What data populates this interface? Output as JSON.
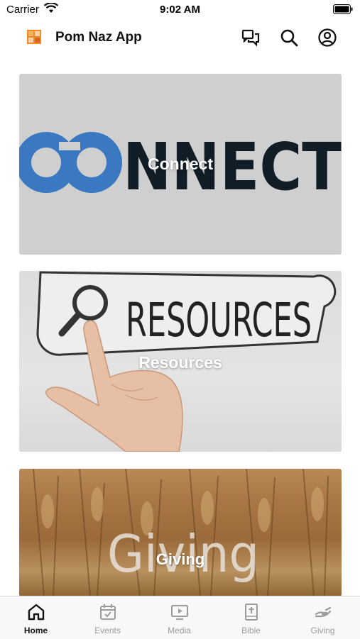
{
  "status_bar": {
    "carrier": "Carrier",
    "time": "9:02 AM"
  },
  "header": {
    "title": "Pom Naz App",
    "icons": [
      "app-logo-icon",
      "chat-icon",
      "search-icon",
      "profile-icon"
    ]
  },
  "cards": [
    {
      "label": "Connect",
      "art_text": "CONNECT"
    },
    {
      "label": "Resources",
      "art_text": "RESOURCES"
    },
    {
      "label": "Giving",
      "art_text": "Giving"
    }
  ],
  "tabs": [
    {
      "label": "Home",
      "icon": "home-icon",
      "active": true
    },
    {
      "label": "Events",
      "icon": "calendar-icon",
      "active": false
    },
    {
      "label": "Media",
      "icon": "media-icon",
      "active": false
    },
    {
      "label": "Bible",
      "icon": "bible-icon",
      "active": false
    },
    {
      "label": "Giving",
      "icon": "giving-icon",
      "active": false
    }
  ],
  "colors": {
    "connect_blue": "#3a78c2",
    "connect_dark": "#101c26",
    "tab_active": "#111111",
    "tab_inactive": "#9b9b9b",
    "logo_orange": "#f08a24"
  }
}
